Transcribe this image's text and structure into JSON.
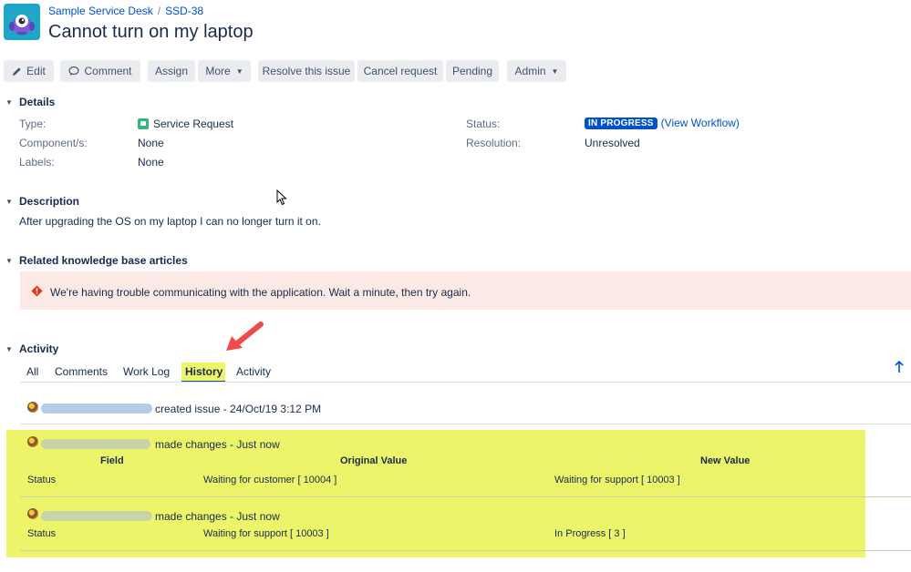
{
  "header": {
    "project": "Sample Service Desk",
    "separator": "/",
    "issue_key": "SSD-38",
    "title": "Cannot turn on my laptop"
  },
  "toolbar": {
    "edit": "Edit",
    "comment": "Comment",
    "assign": "Assign",
    "more": "More",
    "resolve": "Resolve this issue",
    "cancel": "Cancel request",
    "pending": "Pending",
    "admin": "Admin"
  },
  "details": {
    "heading": "Details",
    "type_label": "Type:",
    "type_value": "Service Request",
    "component_label": "Component/s:",
    "component_value": "None",
    "labels_label": "Labels:",
    "labels_value": "None",
    "status_label": "Status:",
    "status_value": "IN PROGRESS",
    "workflow_link": "(View Workflow)",
    "resolution_label": "Resolution:",
    "resolution_value": "Unresolved"
  },
  "description": {
    "heading": "Description",
    "text": "After upgrading the OS on my laptop I can no longer turn it on."
  },
  "kb": {
    "heading": "Related knowledge base articles",
    "error": "We're having trouble communicating with the application. Wait a minute, then try again."
  },
  "activity": {
    "heading": "Activity",
    "tabs": [
      "All",
      "Comments",
      "Work Log",
      "History",
      "Activity"
    ],
    "created": "created issue - 24/Oct/19 3:12 PM",
    "changes": [
      {
        "action": "made changes - Just now",
        "headers": [
          "Field",
          "Original Value",
          "New Value"
        ],
        "field": "Status",
        "original": "Waiting for customer [ 10004 ]",
        "new": "Waiting for support [ 10003 ]"
      },
      {
        "action": "made changes - Just now",
        "field": "Status",
        "original": "Waiting for support [ 10003 ]",
        "new": "In Progress [ 3 ]"
      }
    ]
  },
  "colors": {
    "link": "#0052cc",
    "highlight": "#ecf56a",
    "error_bg": "#fbe9e6",
    "error_icon": "#de350b",
    "annotation_arrow": "#f04a4a"
  }
}
